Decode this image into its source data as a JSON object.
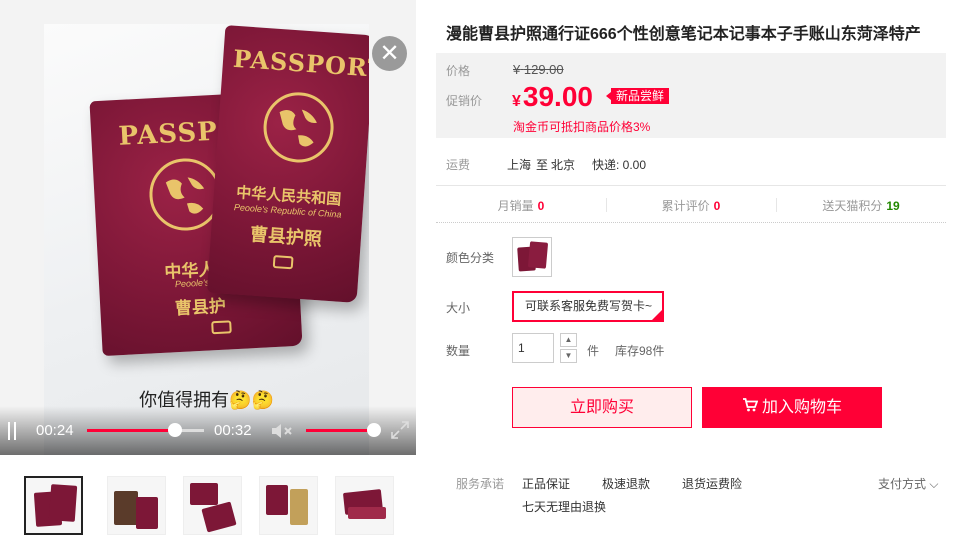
{
  "product": {
    "title": "漫能曹县护照通行证666个性创意笔记本记事本子手账山东菏泽特产"
  },
  "video": {
    "caption": "你值得拥有🤔🤔",
    "current_time": "00:24",
    "total_time": "00:32",
    "progress": 0.75,
    "volume": 1.0,
    "passport_title": "PASSPORT",
    "passport_title_short": "PASSPOR",
    "passport_cn": "中华人民共和国",
    "passport_en": "Peoole's Republic of China",
    "passport_place": "曹县护照",
    "passport_cn_partial": "中华人民",
    "passport_en_partial": "Peoole's Re",
    "passport_place_partial": "曹县护",
    "close_glyph": "✕"
  },
  "thumbnails": {
    "count": 5,
    "active_index": 0
  },
  "price": {
    "orig_label": "价格",
    "orig_currency": "¥",
    "orig_value": "129.00",
    "promo_label": "促销价",
    "promo_currency": "¥",
    "promo_value": "39.00",
    "badge": "新品尝鲜",
    "taojinbi": "淘金币可抵扣商品价格3%"
  },
  "shipping": {
    "label": "运费",
    "from": "上海",
    "to_word": "至",
    "to": "北京",
    "method": "快递: 0.00"
  },
  "stats": {
    "monthly_label": "月销量",
    "monthly_value": "0",
    "reviews_label": "累计评价",
    "reviews_value": "0",
    "points_label": "送天猫积分",
    "points_value": "19"
  },
  "options": {
    "color_label": "颜色分类",
    "size_label": "大小",
    "size_value": "可联系客服免费写贺卡~",
    "qty_label": "数量",
    "qty_value": "1",
    "qty_unit": "件",
    "stock": "库存98件"
  },
  "buttons": {
    "buy": "立即购买",
    "cart": "加入购物车"
  },
  "service": {
    "label": "服务承诺",
    "items": [
      "正品保证",
      "极速退款",
      "退货运费险",
      "七天无理由退换"
    ],
    "pay": "支付方式"
  },
  "colors": {
    "accent": "#ff0036",
    "passport": "#7d1737",
    "gold": "#e9c46a",
    "green": "#228800"
  }
}
